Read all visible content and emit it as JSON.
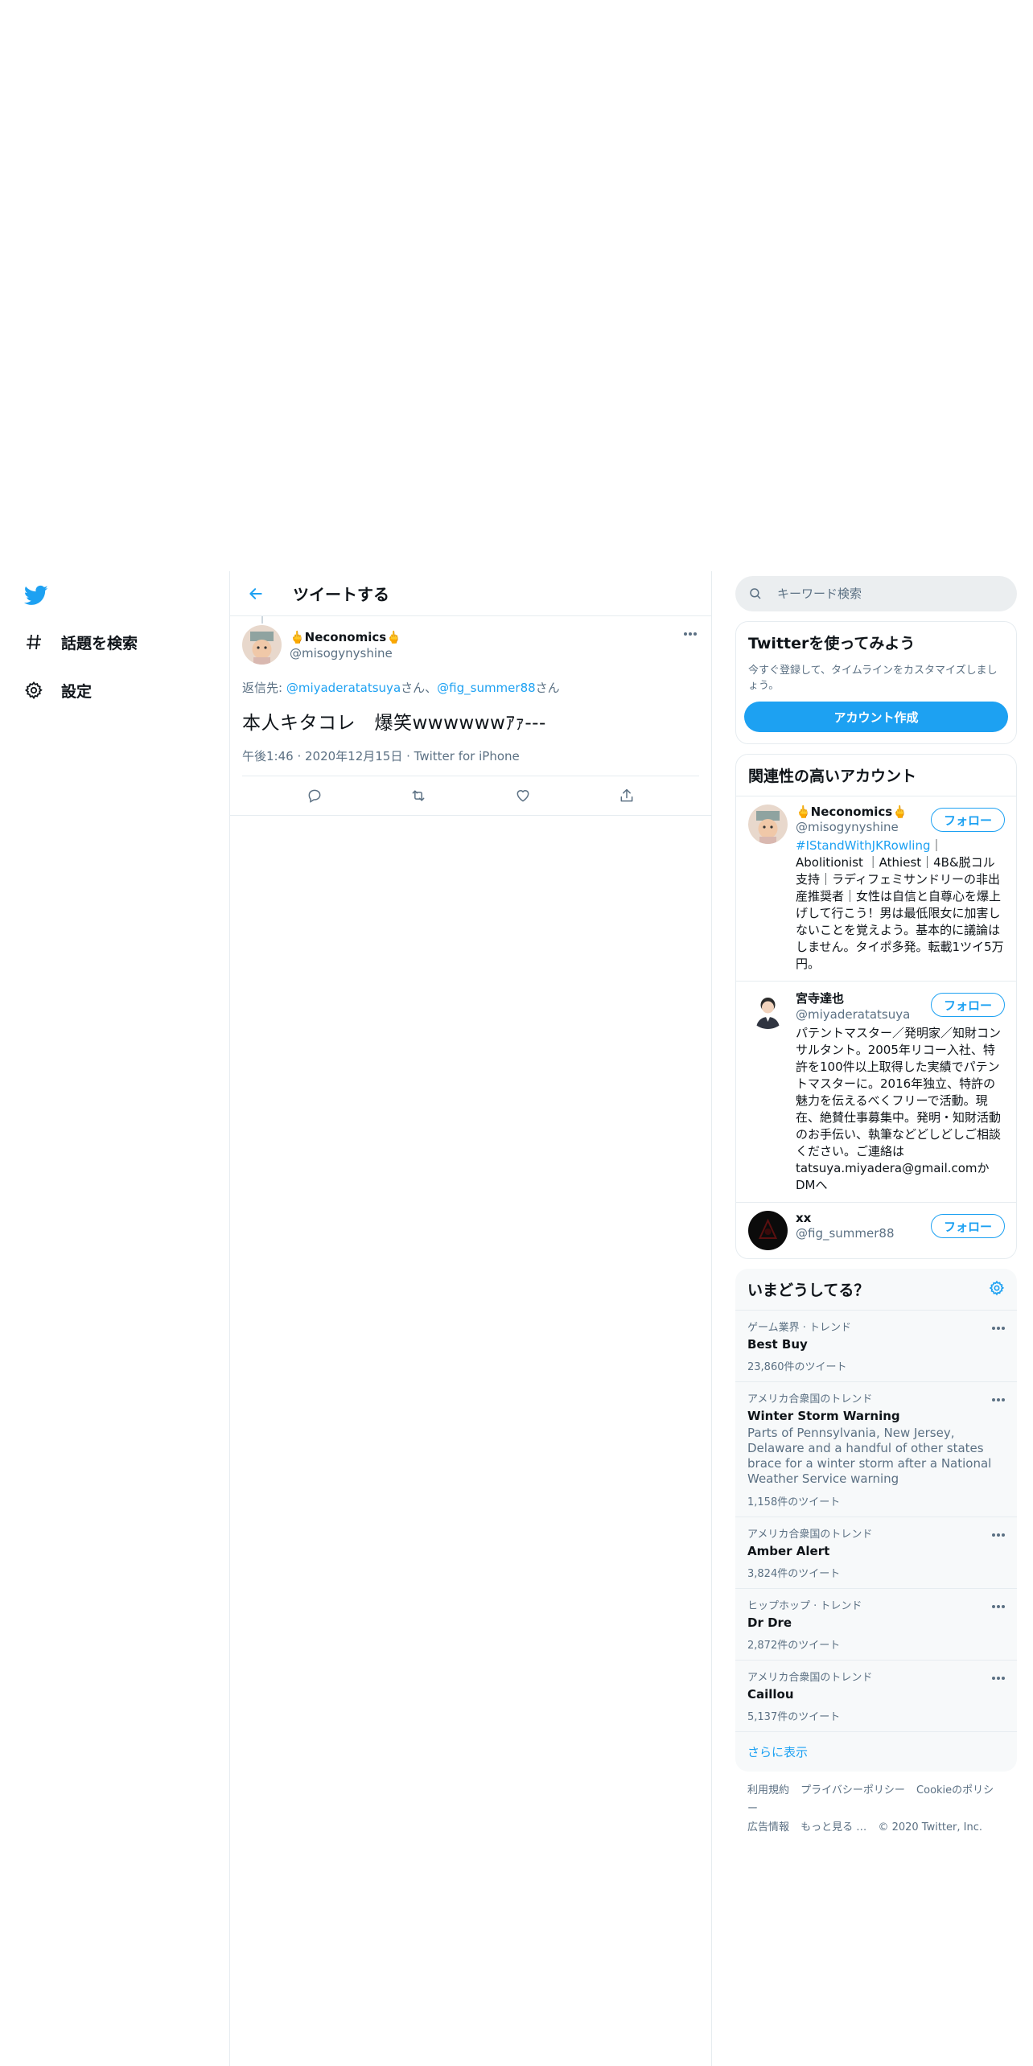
{
  "leftnav": {
    "items": [
      {
        "label": "話題を検索",
        "icon": "hashtag-icon"
      },
      {
        "label": "設定",
        "icon": "gear-icon"
      }
    ]
  },
  "header": {
    "title": "ツイートする"
  },
  "tweet": {
    "display_name": "🖕Neconomics🖕",
    "handle": "@misogynyshine",
    "reply_prefix": "返信先: ",
    "reply_user1": "@miyaderatatsuya",
    "reply_sep": "さん、",
    "reply_user2": "@fig_summer88",
    "reply_suffix": "さん",
    "text": "本人キタコレ　爆笑wwwwwwｱｧ---",
    "time": "午後1:46",
    "date": "2020年12月15日",
    "client": "Twitter for iPhone"
  },
  "search": {
    "placeholder": "キーワード検索"
  },
  "signup": {
    "title": "Twitterを使ってみよう",
    "desc": "今すぐ登録して、タイムラインをカスタマイズしましょう。",
    "button": "アカウント作成"
  },
  "related": {
    "title": "関連性の高いアカウント",
    "follow_label": "フォロー",
    "users": [
      {
        "name": "🖕Neconomics🖕",
        "handle": "@misogynyshine",
        "bio_tag": "#IStandWithJKRowling",
        "bio": "｜Abolitionist ｜Athiest｜4B&脱コル支持｜ラディフェミサンドリーの非出産推奨者｜女性は自信と自尊心を爆上げして行こう！男は最低限女に加害しないことを覚えよう。基本的に議論はしません。タイポ多発。転載1ツイ5万円。"
      },
      {
        "name": "宮寺達也",
        "handle": "@miyaderatatsuya",
        "bio_tag": "",
        "bio": "パテントマスター／発明家／知財コンサルタント。2005年リコー入社、特許を100件以上取得した実績でパテントマスターに。2016年独立、特許の魅力を伝えるべくフリーで活動。現在、絶賛仕事募集中。発明・知財活動のお手伝い、執筆などどしどしご相談ください。ご連絡はtatsuya.miyadera@gmail.comかDMへ"
      },
      {
        "name": "xx",
        "handle": "@fig_summer88",
        "bio_tag": "",
        "bio": ""
      }
    ]
  },
  "trends": {
    "title": "いまどうしてる？",
    "items": [
      {
        "context": "ゲーム業界 · トレンド",
        "name": "Best Buy",
        "desc": "",
        "count": "23,860件のツイート"
      },
      {
        "context": "アメリカ合衆国のトレンド",
        "name": "Winter Storm Warning",
        "desc": "Parts of Pennsylvania, New Jersey, Delaware and a handful of other states brace for a winter storm after a National Weather Service warning",
        "count": "1,158件のツイート"
      },
      {
        "context": "アメリカ合衆国のトレンド",
        "name": "Amber Alert",
        "desc": "",
        "count": "3,824件のツイート"
      },
      {
        "context": "ヒップホップ · トレンド",
        "name": "Dr Dre",
        "desc": "",
        "count": "2,872件のツイート"
      },
      {
        "context": "アメリカ合衆国のトレンド",
        "name": "Caillou",
        "desc": "",
        "count": "5,137件のツイート"
      }
    ],
    "show_more": "さらに表示"
  },
  "footer": {
    "links": [
      "利用規約",
      "プライバシーポリシー",
      "Cookieのポリシー",
      "広告情報",
      "もっと見る …"
    ],
    "copyright": "© 2020 Twitter, Inc."
  },
  "colors": {
    "accent": "#1da1f2",
    "text_secondary": "#5b7083",
    "border": "#e6ecf0"
  }
}
